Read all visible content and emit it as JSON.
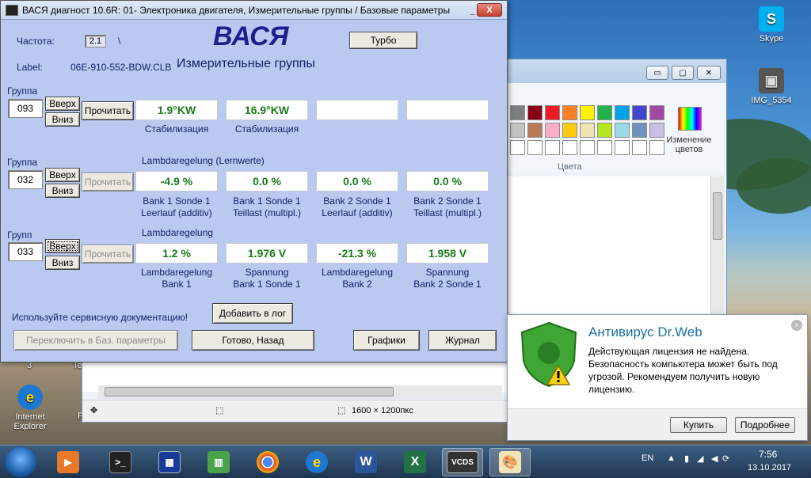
{
  "desktop": {
    "icons": [
      {
        "label": "Skype"
      },
      {
        "label": "IMG_5354"
      },
      {
        "label": "Internet Explorer"
      }
    ],
    "partial_labels": [
      "3",
      "Te",
      "P"
    ]
  },
  "paint": {
    "colors_label": "Цвета",
    "edit_colors_label": "Изменение цветов",
    "image_size": "1600 × 1200пкс",
    "swatches": [
      "#7f7f7f",
      "#880015",
      "#ed1c24",
      "#ff7f27",
      "#fff200",
      "#22b14c",
      "#00a2e8",
      "#3f48cc",
      "#a349a4",
      "#c3c3c3",
      "#b97a57",
      "#ffaec9",
      "#ffc90e",
      "#efe4b0",
      "#b5e61d",
      "#99d9ea",
      "#7092be",
      "#c8bfe7",
      "#ffffff",
      "#ffffff",
      "#ffffff",
      "#ffffff",
      "#ffffff",
      "#ffffff",
      "#ffffff",
      "#ffffff",
      "#ffffff"
    ]
  },
  "vasya": {
    "title": "ВАСЯ диагност 10.6R: 01- Электроника двигателя,  Измерительные группы / Базовые параметры",
    "close_label": "X",
    "minimize_label": "_",
    "logo": "ВАСЯ",
    "freq_label": "Частота:",
    "freq_value": "2.1",
    "freq_sep": "\\",
    "label_label": "Label:",
    "label_value": "06E-910-552-BDW.CLB",
    "subtitle": "Измерительные группы",
    "turbo": "Турбо",
    "up_label": "Вверх",
    "down_label": "Вниз",
    "read_label": "Прочитать",
    "groups": [
      {
        "label": "Группа",
        "number": "093",
        "header": "",
        "values": [
          "1.9°KW",
          "16.9°KW",
          "",
          ""
        ],
        "descs": [
          "Стабилизация",
          "Стабилизация",
          "",
          ""
        ]
      },
      {
        "label": "Группа",
        "number": "032",
        "header": "Lambdaregelung (Lernwerte)",
        "values": [
          "-4.9 %",
          "0.0 %",
          "0.0 %",
          "0.0 %"
        ],
        "descs": [
          "Bank 1 Sonde 1\nLeerlauf (additiv)",
          "Bank 1 Sonde 1\nTeillast (multipl.)",
          "Bank 2 Sonde 1\nLeerlauf (additiv)",
          "Bank 2 Sonde 1\nTeillast (multipl.)"
        ]
      },
      {
        "label": "Групп",
        "number": "033",
        "header": "Lambdaregelung",
        "values": [
          "1.2 %",
          "1.976 V",
          "-21.3 %",
          "1.958 V"
        ],
        "descs": [
          "Lambdaregelung\nBank 1",
          "Spannung\nBank 1 Sonde 1",
          "Lambdaregelung\nBank 2",
          "Spannung\nBank 2 Sonde 1"
        ]
      }
    ],
    "service_doc": "Используйте сервисную документацию!",
    "add_log": "Добавить в лог",
    "switch_basic": "Переключить в Баз. параметры",
    "done_back": "Готово, Назад",
    "graphs": "Графики",
    "journal": "Журнал"
  },
  "drweb": {
    "title": "Антивирус Dr.Web",
    "body": "Действующая лицензия не найдена. Безопасность компьютера может быть под угрозой. Рекомендуем получить новую лицензию.",
    "buy": "Купить",
    "more": "Подробнее",
    "close": "×"
  },
  "taskbar": {
    "lang": "EN",
    "time": "7:56",
    "date": "13.10.2017",
    "vcds_label": "VCDS",
    "word_label": "W",
    "excel_label": "X",
    "ie_label": "e"
  }
}
